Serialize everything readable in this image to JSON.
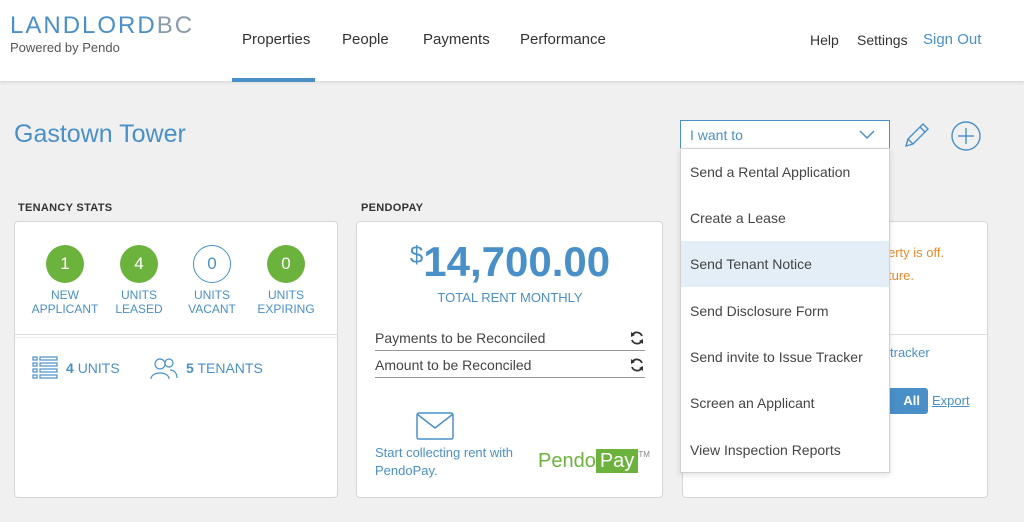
{
  "header": {
    "logo_main": "LANDLORD",
    "logo_bc": "BC",
    "logo_sub": "Powered by Pendo",
    "nav": [
      "Properties",
      "People",
      "Payments",
      "Performance"
    ],
    "help": "Help",
    "settings": "Settings",
    "signout": "Sign Out"
  },
  "page": {
    "title": "Gastown Tower",
    "iwant_label": "I want to"
  },
  "tenancy": {
    "label": "TENANCY STATS",
    "stats": [
      {
        "value": "1",
        "line1": "NEW",
        "line2": "APPLICANT"
      },
      {
        "value": "4",
        "line1": "UNITS",
        "line2": "LEASED"
      },
      {
        "value": "0",
        "line1": "UNITS",
        "line2": "VACANT"
      },
      {
        "value": "0",
        "line1": "UNITS",
        "line2": "EXPIRING"
      }
    ],
    "units_count": "4",
    "units_label": "UNITS",
    "tenants_count": "5",
    "tenants_label": "TENANTS"
  },
  "pendopay": {
    "label": "PENDOPAY",
    "currency": "$",
    "amount": "14,700.00",
    "amount_label": "TOTAL RENT MONTHLY",
    "recon1": "Payments to be Reconciled",
    "recon2": "Amount to be Reconciled",
    "start_text": "Start collecting rent with PendoPay.",
    "logo_a": "Pendo",
    "logo_b": "Pay",
    "logo_tm": "TM"
  },
  "card3": {
    "orange1": "erty is off.",
    "orange2": "ture.",
    "tracker": "tracker",
    "all_btn": "All",
    "export": "Export"
  },
  "dropdown": {
    "items": [
      "Send a Rental Application",
      "Create a Lease",
      "Send Tenant Notice",
      "Send Disclosure Form",
      "Send invite to Issue Tracker",
      "Screen an Applicant",
      "View Inspection Reports"
    ],
    "active_item": "Send Tenant Notice"
  },
  "colors": {
    "accent": "#4a90c8",
    "green": "#6cb33e",
    "orange": "#e98a2e",
    "background": "#f0f0f0"
  }
}
